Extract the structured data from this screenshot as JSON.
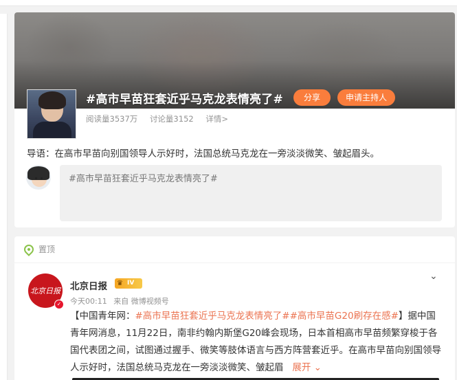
{
  "topic": {
    "title": "#高市早苗狂套近乎马克龙表情亮了#",
    "share_label": "分享",
    "host_label": "申请主持人",
    "reads": "阅读量3537万",
    "discussions": "讨论量3152",
    "details": "详情>",
    "intro": "导语：在高市早苗向别国领导人示好时，法国总统马克龙在一旁淡淡微笑、皱起眉头。",
    "compose_text": "#高市早苗狂套近乎马克龙表情亮了#"
  },
  "post": {
    "pinned_label": "置顶",
    "author": "北京日报",
    "logo_text": "北京日报",
    "level": "IV",
    "time": "今天00:11",
    "source": "来自 微博视频号",
    "body_prefix": "【中国青年网：",
    "hashtag1": "#高市早苗狂套近乎马克龙表情亮了#",
    "hashtag2": "#高市早苗G20刷存在感#",
    "body_rest": "】据中国青年网消息，11月22日，南非约翰内斯堡G20峰会现场，日本首相高市早苗频繁穿梭于各国代表团之间，试图通过握手、微笑等肢体语言与西方阵营套近乎。在高市早苗向别国领导人示好时，法国总统马克龙在一旁淡淡微笑、皱起眉",
    "expand_label": "展开"
  },
  "icons": {
    "pin": "location-pin-icon",
    "chevron": "chevron-down-icon",
    "verify": "verified-badge-icon",
    "crown": "crown-icon"
  },
  "colors": {
    "accent_orange": "#fa7d3c",
    "link_orange": "#eb7350",
    "brand_red": "#c8161d"
  }
}
